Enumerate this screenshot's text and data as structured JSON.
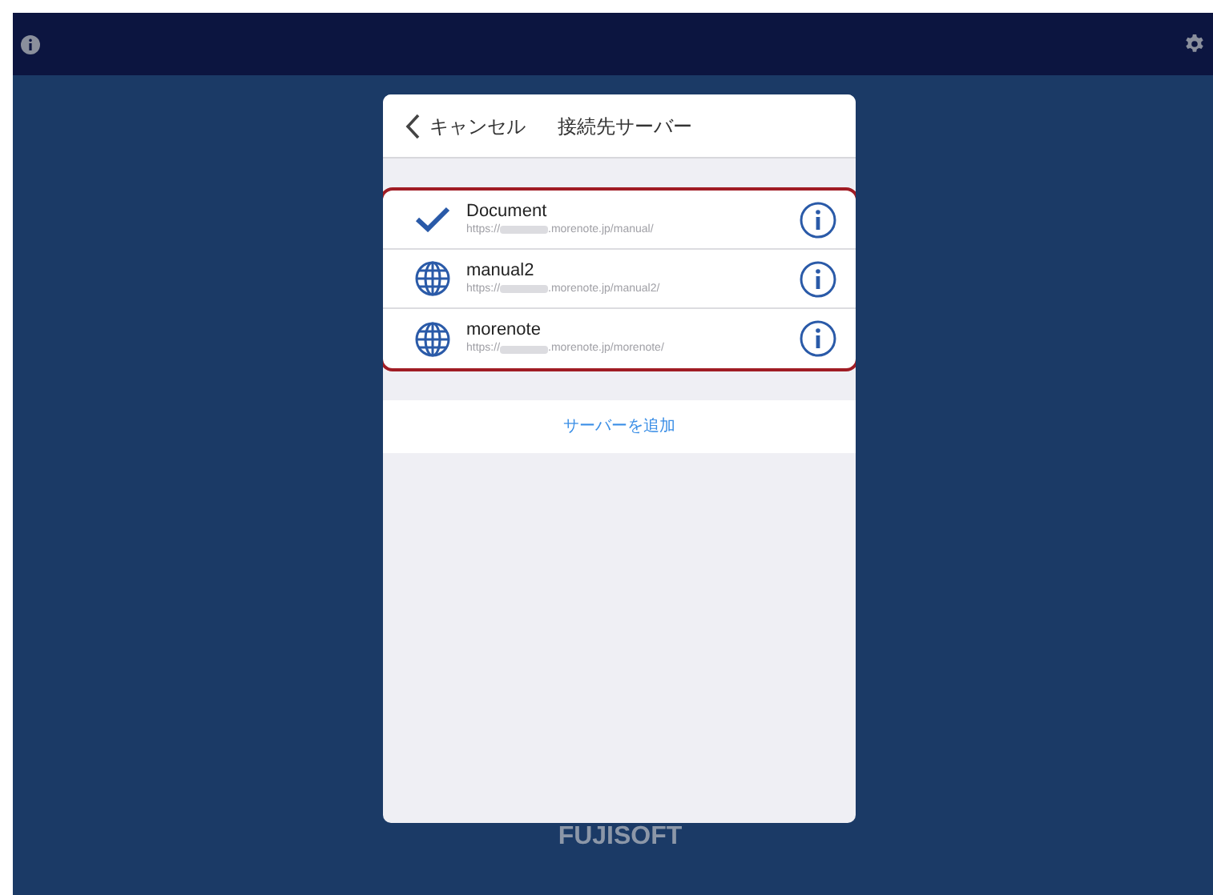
{
  "dialog": {
    "back_label": "キャンセル",
    "title": "接続先サーバー"
  },
  "servers": [
    {
      "name": "Document",
      "url_prefix": "https://",
      "url_suffix": ".morenote.jp/manual/",
      "selected": true
    },
    {
      "name": "manual2",
      "url_prefix": "https://",
      "url_suffix": ".morenote.jp/manual2/",
      "selected": false
    },
    {
      "name": "morenote",
      "url_prefix": "https://",
      "url_suffix": ".morenote.jp/morenote/",
      "selected": false
    }
  ],
  "add_button": "サーバーを追加",
  "brand": "FUJISOFT"
}
